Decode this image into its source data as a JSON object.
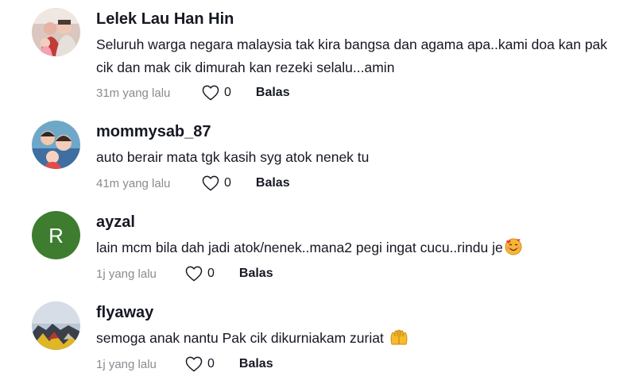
{
  "comments": [
    {
      "username": "Lelek Lau Han Hin",
      "text": "Seluruh warga negara malaysia tak kira bangsa dan agama apa..kami doa kan pak cik dan mak cik dimurah kan rezeki selalu...amin",
      "time": "31m yang lalu",
      "likes": "0",
      "reply_label": "Balas",
      "avatar": "photo"
    },
    {
      "username": "mommysab_87",
      "text": "auto berair mata tgk kasih syg atok nenek tu",
      "time": "41m yang lalu",
      "likes": "0",
      "reply_label": "Balas",
      "avatar": "photo"
    },
    {
      "username": "ayzal",
      "text": "lain mcm bila dah jadi atok/nenek..mana2 pegi ingat cucu..rindu je",
      "emoji": "smiling-face-with-hearts",
      "time": "1j yang lalu",
      "likes": "0",
      "reply_label": "Balas",
      "avatar_letter": "R",
      "avatar_color": "#3e7c2f"
    },
    {
      "username": "flyaway",
      "text": "semoga anak nantu Pak cik dikurniakam zuriat",
      "emoji": "open-hands",
      "time": "1j yang lalu",
      "likes": "0",
      "reply_label": "Balas",
      "avatar": "photo"
    }
  ],
  "icons": {
    "like": "heart-outline-icon"
  },
  "colors": {
    "text": "#161823",
    "muted": "#8a8b91",
    "avatar_r": "#3e7c2f"
  }
}
